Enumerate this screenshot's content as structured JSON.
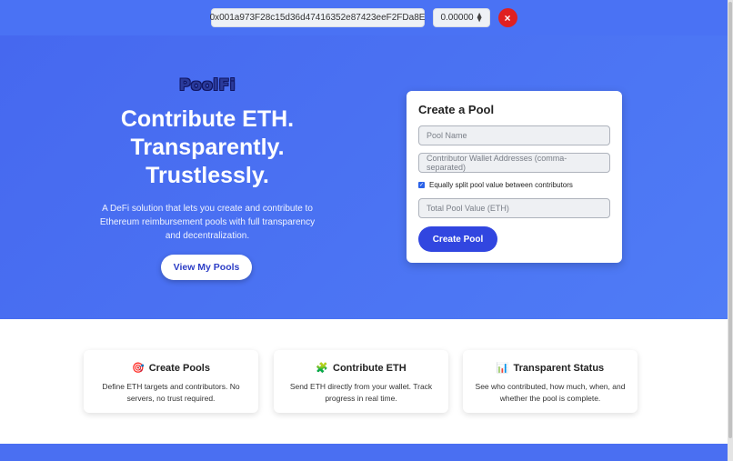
{
  "wallet": {
    "address": "0x001a973F28c15d36d47416352e87423eeF2FDa8E",
    "balance": "0.00000",
    "balance_icon": "ethereum-icon",
    "disconnect_label": "×"
  },
  "hero": {
    "logo": "PoolFi",
    "headline_lines": [
      "Contribute ETH.",
      "Transparently.",
      "Trustlessly."
    ],
    "tagline": "A DeFi solution that lets you create and contribute to Ethereum reimbursement pools with full transparency and decentralization.",
    "view_pools_label": "View My Pools"
  },
  "create_pool": {
    "title": "Create a Pool",
    "pool_name_placeholder": "Pool Name",
    "contributors_placeholder": "Contributor Wallet Addresses (comma-separated)",
    "split_label": "Equally split pool value between contributors",
    "split_checked": true,
    "total_value_placeholder": "Total Pool Value (ETH)",
    "submit_label": "Create Pool"
  },
  "features": [
    {
      "icon": "🎯",
      "title": "Create Pools",
      "desc": "Define ETH targets and contributors. No servers, no trust required."
    },
    {
      "icon": "🧩",
      "title": "Contribute ETH",
      "desc": "Send ETH directly from your wallet. Track progress in real time."
    },
    {
      "icon": "📊",
      "title": "Transparent Status",
      "desc": "See who contributed, how much, when, and whether the pool is complete."
    }
  ],
  "colors": {
    "hero_bg": "#4a72f4",
    "primary_button": "#3146e0",
    "disconnect": "#e02020"
  }
}
